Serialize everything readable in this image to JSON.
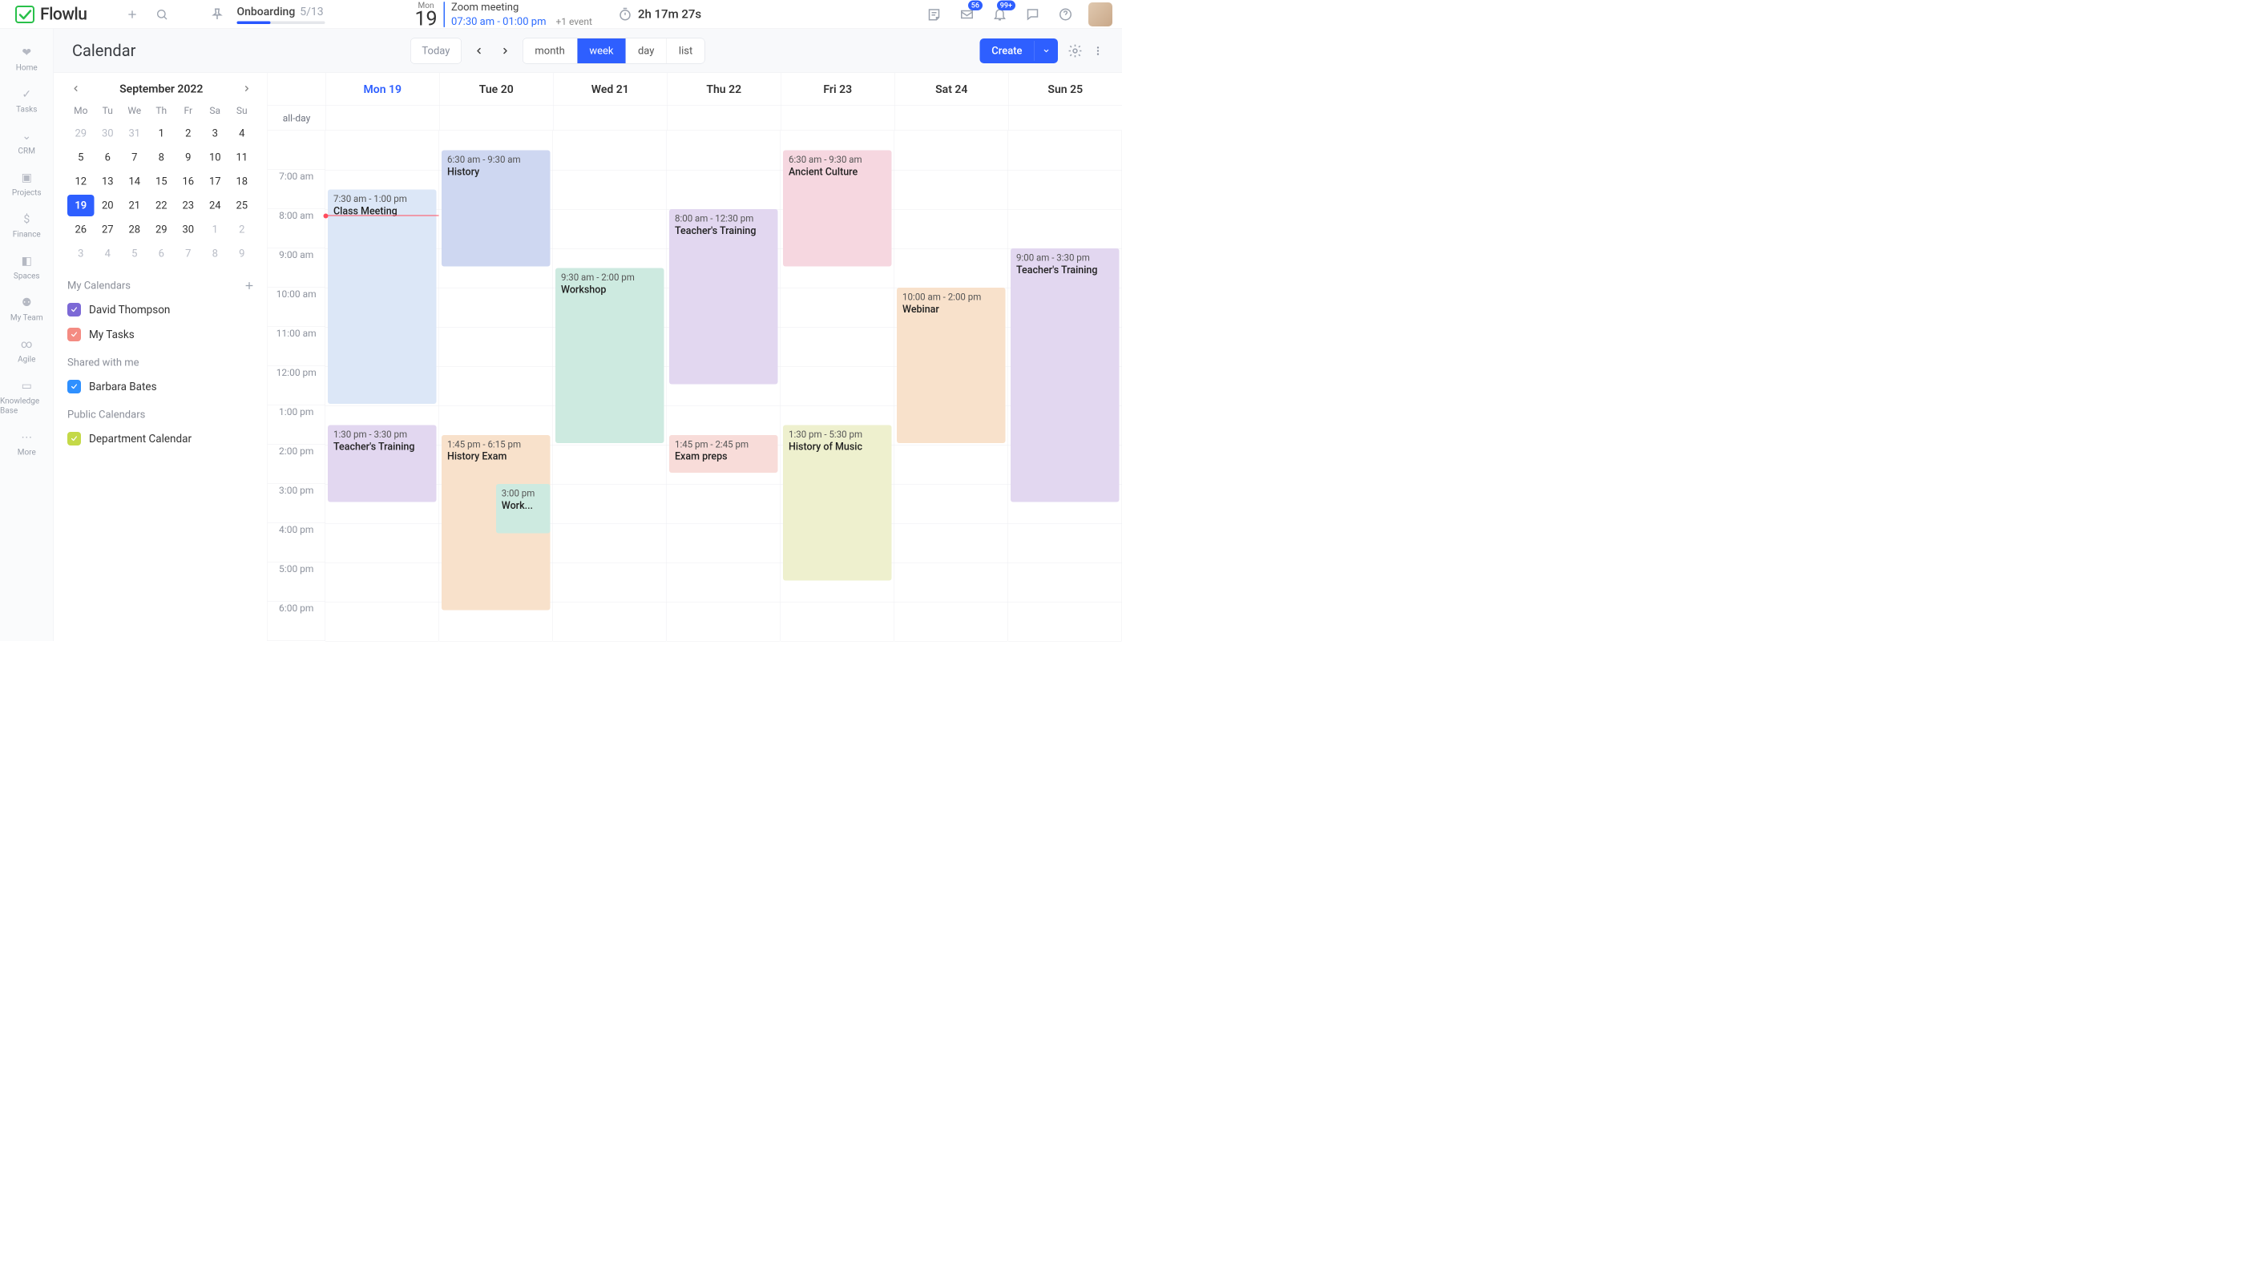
{
  "app": {
    "name": "Flowlu"
  },
  "topbar": {
    "onboarding": {
      "label": "Onboarding",
      "count": "5/13"
    },
    "date": {
      "dow": "Mon",
      "num": "19"
    },
    "meeting": {
      "title": "Zoom meeting",
      "time": "07:30 am - 01:00 pm",
      "extra": "+1 event"
    },
    "timer": "2h 17m 27s",
    "inboxBadge": "56",
    "bellBadge": "99+"
  },
  "rail": [
    {
      "label": "Home"
    },
    {
      "label": "Tasks"
    },
    {
      "label": "CRM"
    },
    {
      "label": "Projects"
    },
    {
      "label": "Finance"
    },
    {
      "label": "Spaces"
    },
    {
      "label": "My Team"
    },
    {
      "label": "Agile"
    },
    {
      "label": "Knowledge Base"
    },
    {
      "label": "More"
    }
  ],
  "page": {
    "title": "Calendar",
    "today": "Today",
    "views": [
      "month",
      "week",
      "day",
      "list"
    ],
    "activeView": "week",
    "create": "Create"
  },
  "miniCal": {
    "title": "September 2022",
    "dows": [
      "Mo",
      "Tu",
      "We",
      "Th",
      "Fr",
      "Sa",
      "Su"
    ],
    "days": [
      {
        "n": "29",
        "o": true
      },
      {
        "n": "30",
        "o": true
      },
      {
        "n": "31",
        "o": true
      },
      {
        "n": "1"
      },
      {
        "n": "2"
      },
      {
        "n": "3"
      },
      {
        "n": "4"
      },
      {
        "n": "5"
      },
      {
        "n": "6"
      },
      {
        "n": "7"
      },
      {
        "n": "8"
      },
      {
        "n": "9"
      },
      {
        "n": "10"
      },
      {
        "n": "11"
      },
      {
        "n": "12"
      },
      {
        "n": "13"
      },
      {
        "n": "14"
      },
      {
        "n": "15"
      },
      {
        "n": "16"
      },
      {
        "n": "17"
      },
      {
        "n": "18"
      },
      {
        "n": "19",
        "t": true
      },
      {
        "n": "20"
      },
      {
        "n": "21"
      },
      {
        "n": "22"
      },
      {
        "n": "23"
      },
      {
        "n": "24"
      },
      {
        "n": "25"
      },
      {
        "n": "26"
      },
      {
        "n": "27"
      },
      {
        "n": "28"
      },
      {
        "n": "29"
      },
      {
        "n": "30"
      },
      {
        "n": "1",
        "o": true
      },
      {
        "n": "2",
        "o": true
      },
      {
        "n": "3",
        "o": true
      },
      {
        "n": "4",
        "o": true
      },
      {
        "n": "5",
        "o": true
      },
      {
        "n": "6",
        "o": true
      },
      {
        "n": "7",
        "o": true
      },
      {
        "n": "8",
        "o": true
      },
      {
        "n": "9",
        "o": true
      }
    ]
  },
  "myCalendars": {
    "label": "My Calendars",
    "items": [
      {
        "name": "David Thompson",
        "color": "purple"
      },
      {
        "name": "My Tasks",
        "color": "salmon"
      }
    ]
  },
  "sharedLabel": "Shared with me",
  "sharedItems": [
    {
      "name": "Barbara Bates",
      "color": "blue"
    }
  ],
  "publicLabel": "Public Calendars",
  "publicItems": [
    {
      "name": "Department Calendar",
      "color": "lime"
    }
  ],
  "week": {
    "gridStartHour": 6,
    "hourPx": 98,
    "nowHour": 8.15,
    "allDayLabel": "all-day",
    "days": [
      "Mon 19",
      "Tue 20",
      "Wed 21",
      "Thu 22",
      "Fri 23",
      "Sat 24",
      "Sun 25"
    ],
    "todayIndex": 0,
    "hours": [
      "7:00 am",
      "8:00 am",
      "9:00 am",
      "10:00 am",
      "11:00 am",
      "12:00 pm",
      "1:00 pm",
      "2:00 pm",
      "3:00 pm",
      "4:00 pm",
      "5:00 pm",
      "6:00 pm"
    ],
    "events": [
      {
        "day": 0,
        "time": "7:30 am - 1:00 pm",
        "name": "Class Meeting",
        "cls": "ev-blue",
        "start": 7.5,
        "end": 13.0
      },
      {
        "day": 0,
        "time": "1:30 pm - 3:30 pm",
        "name": "Teacher's Training",
        "cls": "ev-purple",
        "start": 13.5,
        "end": 15.5
      },
      {
        "day": 1,
        "time": "6:30 am - 9:30 am",
        "name": "History",
        "cls": "ev-indigo",
        "start": 6.5,
        "end": 9.5
      },
      {
        "day": 1,
        "time": "1:45 pm - 6:15 pm",
        "name": "History Exam",
        "cls": "ev-orange",
        "start": 13.75,
        "end": 18.25
      },
      {
        "day": 1,
        "time": "3:00 pm",
        "name": "Work...",
        "cls": "ev-teal",
        "start": 15.0,
        "end": 16.3,
        "half": true
      },
      {
        "day": 2,
        "time": "9:30 am - 2:00 pm",
        "name": "Workshop",
        "cls": "ev-teal",
        "start": 9.5,
        "end": 14.0
      },
      {
        "day": 3,
        "time": "8:00 am - 12:30 pm",
        "name": "Teacher's Training",
        "cls": "ev-purple",
        "start": 8.0,
        "end": 12.5
      },
      {
        "day": 3,
        "time": "1:45 pm - 2:45 pm",
        "name": "Exam preps",
        "cls": "ev-rose",
        "start": 13.75,
        "end": 14.75
      },
      {
        "day": 4,
        "time": "6:30 am - 9:30 am",
        "name": "Ancient Culture",
        "cls": "ev-pink",
        "start": 6.5,
        "end": 9.5
      },
      {
        "day": 4,
        "time": "1:30 pm - 5:30 pm",
        "name": "History of Music",
        "cls": "ev-yellow",
        "start": 13.5,
        "end": 17.5
      },
      {
        "day": 5,
        "time": "10:00 am - 2:00 pm",
        "name": "Webinar",
        "cls": "ev-orange",
        "start": 10.0,
        "end": 14.0
      },
      {
        "day": 6,
        "time": "9:00 am - 3:30 pm",
        "name": "Teacher's Training",
        "cls": "ev-purple",
        "start": 9.0,
        "end": 15.5
      }
    ]
  }
}
